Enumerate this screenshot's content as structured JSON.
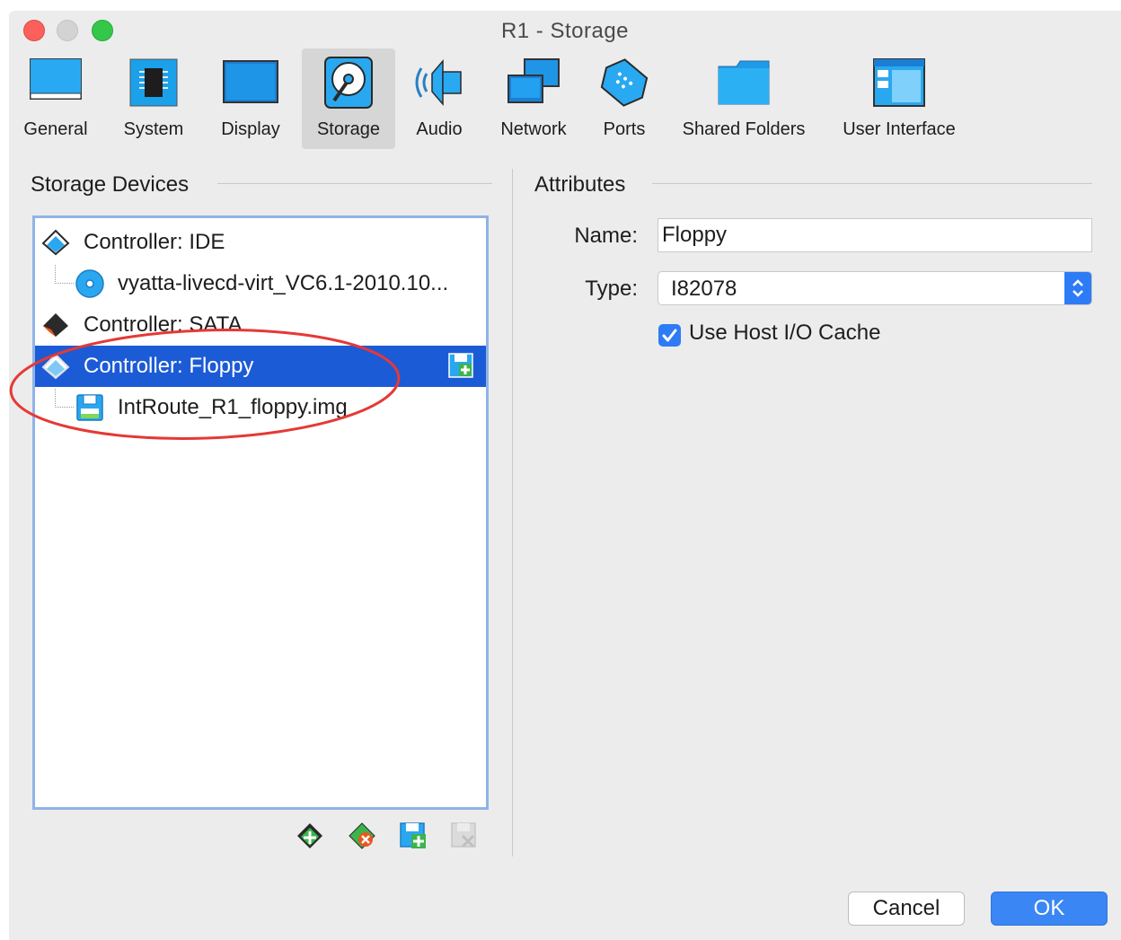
{
  "window": {
    "title": "R1 - Storage"
  },
  "toolbar": {
    "items": [
      {
        "label": "General",
        "icon": "general-icon"
      },
      {
        "label": "System",
        "icon": "system-chip-icon"
      },
      {
        "label": "Display",
        "icon": "display-monitor-icon"
      },
      {
        "label": "Storage",
        "icon": "storage-disk-icon",
        "active": true
      },
      {
        "label": "Audio",
        "icon": "audio-speaker-icon"
      },
      {
        "label": "Network",
        "icon": "network-icon"
      },
      {
        "label": "Ports",
        "icon": "ports-icon"
      },
      {
        "label": "Shared Folders",
        "icon": "shared-folder-icon"
      },
      {
        "label": "User Interface",
        "icon": "user-interface-icon"
      }
    ]
  },
  "storage": {
    "title": "Storage Devices",
    "tree": [
      {
        "label": "Controller: IDE",
        "icon": "ide-controller-icon"
      },
      {
        "label": "vyatta-livecd-virt_VC6.1-2010.10...",
        "icon": "optical-disc-icon"
      },
      {
        "label": "Controller: SATA",
        "icon": "sata-controller-icon"
      },
      {
        "label": "Controller: Floppy",
        "icon": "floppy-controller-icon",
        "selected": true
      },
      {
        "label": "IntRoute_R1_floppy.img",
        "icon": "floppy-disk-icon"
      }
    ],
    "buttons": [
      "add-controller-icon",
      "remove-controller-icon",
      "add-attachment-icon",
      "remove-attachment-icon"
    ]
  },
  "attributes": {
    "title": "Attributes",
    "name_label": "Name:",
    "name_value": "Floppy",
    "type_label": "Type:",
    "type_value": "I82078",
    "cache_label": "Use Host I/O Cache",
    "cache_checked": true
  },
  "footer": {
    "cancel": "Cancel",
    "ok": "OK"
  },
  "colors": {
    "selection": "#1c5bd6",
    "accent": "#2d7cf6",
    "annotation": "#e53935"
  }
}
